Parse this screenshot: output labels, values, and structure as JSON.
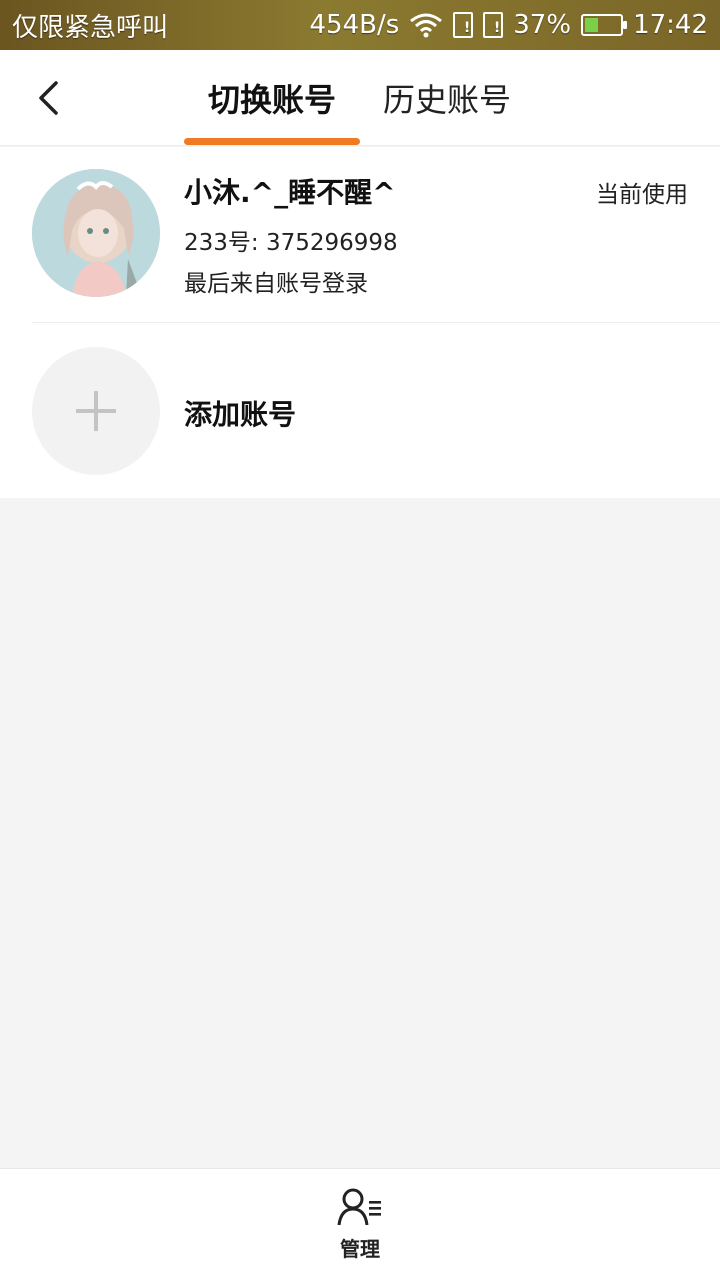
{
  "status_bar": {
    "carrier": "仅限紧急呼叫",
    "speed": "454B/s",
    "battery": "37%",
    "battery_level": 0.37,
    "time": "17:42"
  },
  "header": {
    "tabs": [
      {
        "label": "切换账号",
        "active": true
      },
      {
        "label": "历史账号",
        "active": false
      }
    ],
    "accent_color": "#f07a22"
  },
  "accounts": [
    {
      "name": "小沐.^_睡不醒^",
      "id_line": "233号: 375296998",
      "login_line": "最后来自账号登录",
      "badge": "当前使用"
    }
  ],
  "add_account": {
    "label": "添加账号"
  },
  "bottom": {
    "manage_label": "管理"
  }
}
